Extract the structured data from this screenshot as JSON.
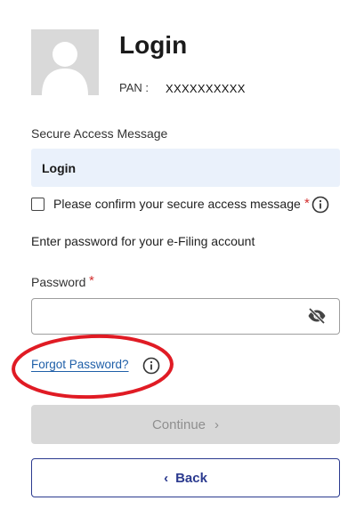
{
  "header": {
    "title": "Login",
    "pan_label": "PAN :",
    "pan_value": "XXXXXXXXXX"
  },
  "secure_access": {
    "label": "Secure Access Message",
    "value": "Login"
  },
  "confirm": {
    "label": "Please confirm your secure access message",
    "required_mark": "*"
  },
  "instructions": "Enter password for your e-Filing account",
  "password": {
    "label": "Password",
    "required_mark": "*",
    "value": ""
  },
  "forgot_password": "Forgot Password?",
  "buttons": {
    "continue_label": "Continue",
    "continue_chevron": "›",
    "back_label": "Back",
    "back_chevron": "‹"
  },
  "colors": {
    "accent": "#2b3a8f",
    "link": "#1f5fa8",
    "required": "#d32f2f",
    "highlight_ellipse": "#e01b24",
    "message_box": "#eaf1fb",
    "disabled_button": "#d8d8d8"
  },
  "icons": [
    "user-avatar-icon",
    "info-icon",
    "eye-slash-icon",
    "chevron-right-icon",
    "chevron-left-icon"
  ]
}
